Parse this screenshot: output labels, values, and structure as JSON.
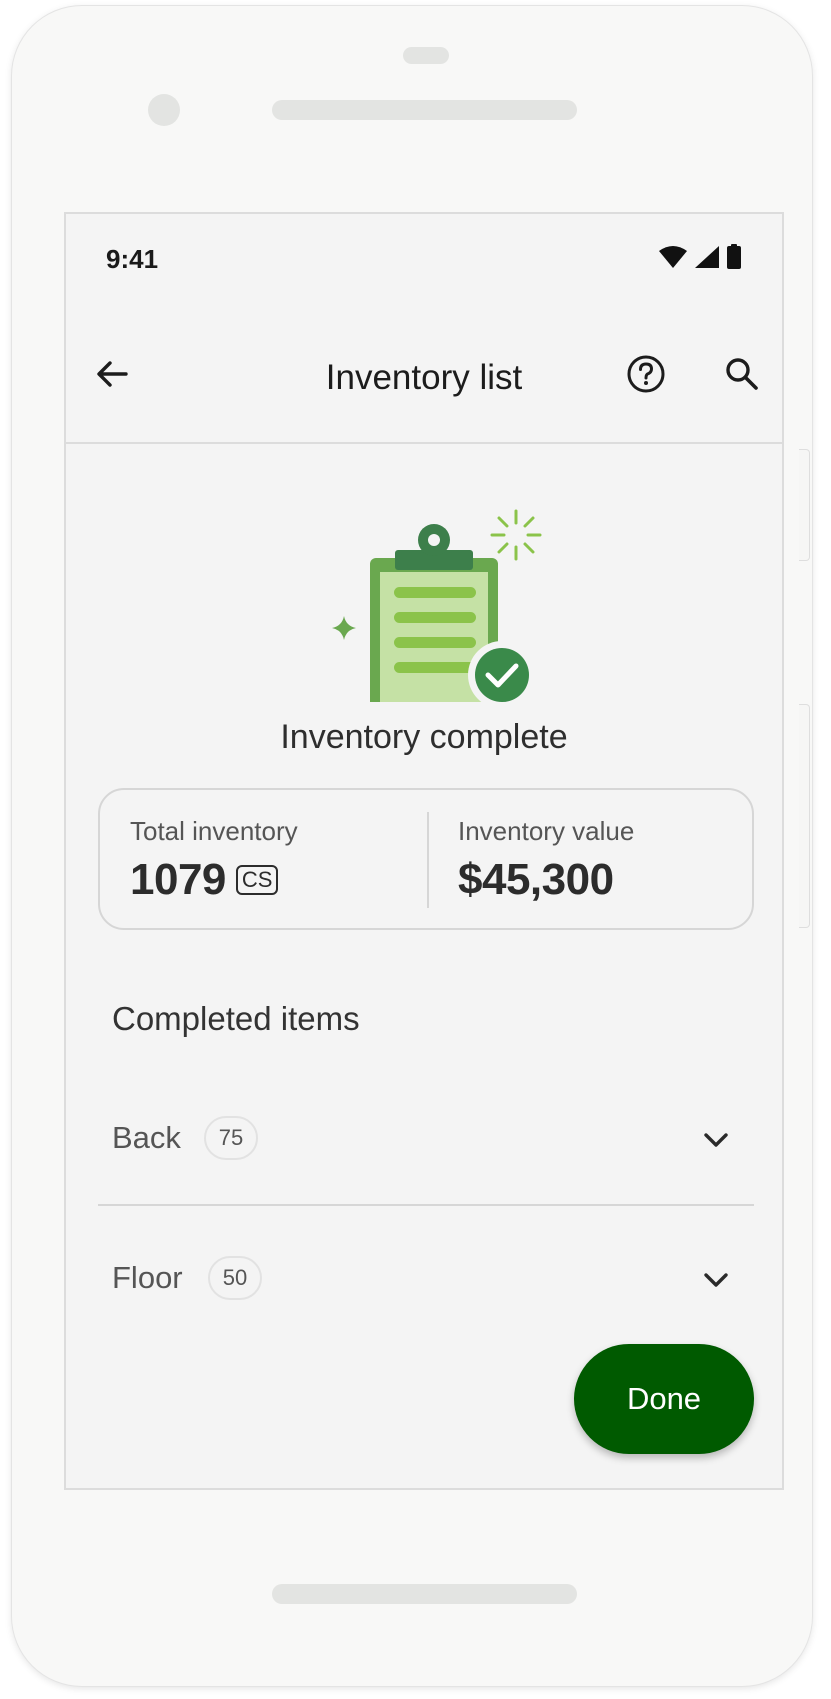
{
  "status_bar": {
    "time": "9:41",
    "icons": [
      "wifi-icon",
      "cellular-signal-icon",
      "battery-icon"
    ]
  },
  "app_bar": {
    "title": "Inventory list",
    "back_icon": "arrow-back-icon",
    "help_icon": "help-circle-icon",
    "search_icon": "search-icon"
  },
  "illustration": {
    "icon": "clipboard-check-icon",
    "colors": {
      "clipboard": "#6aa84f",
      "paper": "#c5e1a5",
      "lines": "#8bc34a",
      "check_badge": "#3a8a4a",
      "clip": "#3d7f4b",
      "sparkle": "#8bc34a"
    }
  },
  "complete_title": "Inventory complete",
  "summary": {
    "total": {
      "label": "Total inventory",
      "value": "1079",
      "unit": "CS"
    },
    "value": {
      "label": "Inventory value",
      "value": "$45,300"
    }
  },
  "completed_items": {
    "title": "Completed items",
    "rows": [
      {
        "label": "Back",
        "count": "75"
      },
      {
        "label": "Floor",
        "count": "50"
      }
    ]
  },
  "done_button": {
    "label": "Done",
    "color": "#005a00"
  }
}
